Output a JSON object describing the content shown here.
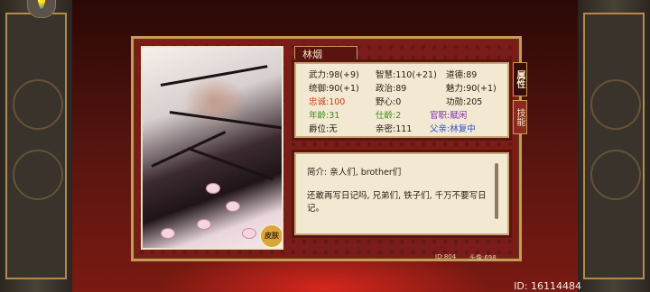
{
  "character": {
    "name": "林烟"
  },
  "tabs": [
    {
      "label": "属性",
      "active": true
    },
    {
      "label": "技能",
      "active": false
    }
  ],
  "stats": {
    "wuli": "武力:98(+9)",
    "zhihui": "智慧:110(+21)",
    "daode": "道德:89",
    "tongyu": "统御:90(+1)",
    "zhengzhi": "政治:89",
    "meili": "魅力:90(+1)",
    "zhongcheng": "忠诚:100",
    "yexin": "野心:0",
    "gongxun": "功勋:205",
    "nianling": "年龄:31",
    "shiling": "仕龄:2",
    "guanzhi": "官职:赋闲",
    "jueewi": "爵位:无",
    "qinmi": "亲密:111",
    "fuqin": "父亲:林复中"
  },
  "description": {
    "intro": "简介: 亲人们, brother们",
    "body": "还敢再写日记吗, 兄弟们, 铁子们, 千万不要写日记。"
  },
  "footer": {
    "id_code": "ID:804",
    "portrait_code": "头像:698",
    "player_id": "ID: 16114484"
  },
  "badges": {
    "skin": "皮肤"
  },
  "colors": {
    "loyalty": "#d03a14",
    "age": "#3a8a1e",
    "office": "#7a2ab0",
    "father": "#2a52c8"
  }
}
